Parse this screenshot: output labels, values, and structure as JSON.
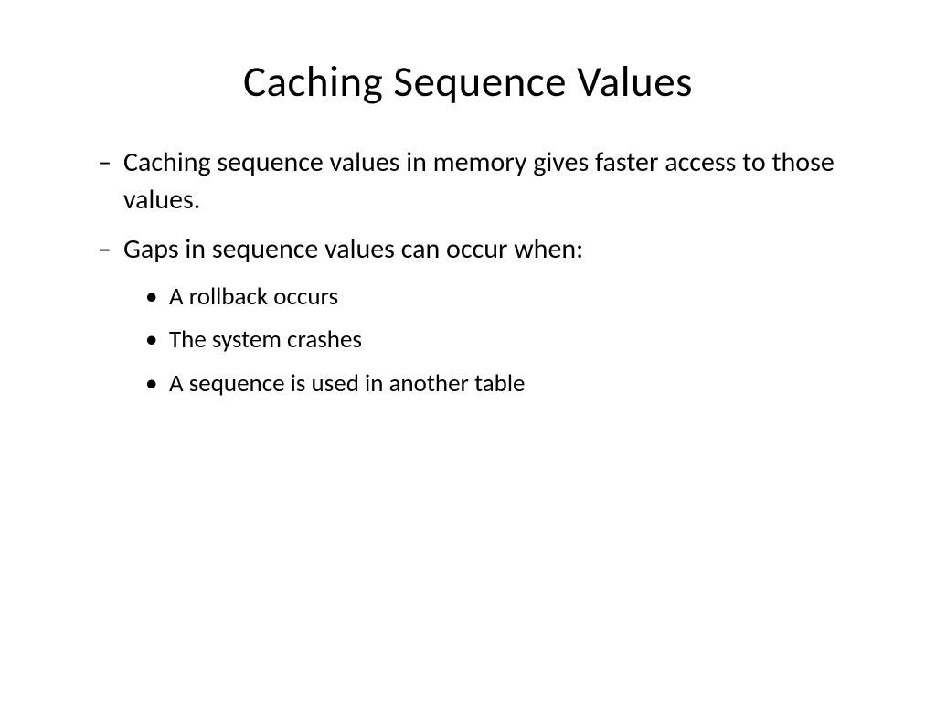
{
  "slide": {
    "title": "Caching Sequence Values",
    "bullets": [
      {
        "text": "Caching sequence values in memory gives faster access to those values."
      },
      {
        "text": "Gaps in sequence values can occur when:",
        "sub": [
          "A rollback occurs",
          "The system crashes",
          "A sequence is used in another table"
        ]
      }
    ]
  }
}
